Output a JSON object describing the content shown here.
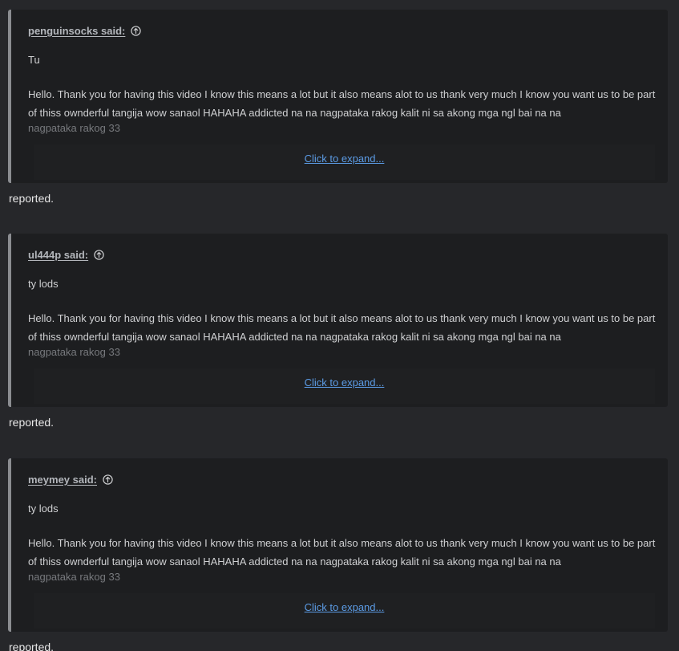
{
  "posts": [
    {
      "quote_author": "penguinsocks said:",
      "quote_short": "Tu",
      "quote_long": "Hello. Thank you for having this video I know this means a lot but it also means alot to us thank very much I know you want us to be part of thiss ownderful tangija wow sanaol HAHAHA addicted na na nagpataka rakog kalit ni sa akong mga ngl bai na na",
      "quote_fade": "nagpataka rakog 33",
      "expand_label": "Click to expand...",
      "reply": "reported."
    },
    {
      "quote_author": "ul444p said:",
      "quote_short": "ty lods",
      "quote_long": "Hello. Thank you for having this video I know this means a lot but it also means alot to us thank very much I know you want us to be part of thiss ownderful tangija wow sanaol HAHAHA addicted na na nagpataka rakog kalit ni sa akong mga ngl bai na na",
      "quote_fade": "nagpataka rakog 33",
      "expand_label": "Click to expand...",
      "reply": "reported."
    },
    {
      "quote_author": "meymey said:",
      "quote_short": "ty lods",
      "quote_long": "Hello. Thank you for having this video I know this means a lot but it also means alot to us thank very much I know you want us to be part of thiss ownderful tangija wow sanaol HAHAHA addicted na na nagpataka rakog kalit ni sa akong mga ngl bai na na",
      "quote_fade": "nagpataka rakog 33",
      "expand_label": "Click to expand...",
      "reply": "reported."
    }
  ],
  "icons": {
    "quote_jump": "arrow-up-circle-icon"
  },
  "colors": {
    "link": "#5c9ce6",
    "quote_border": "#8b8d91"
  }
}
